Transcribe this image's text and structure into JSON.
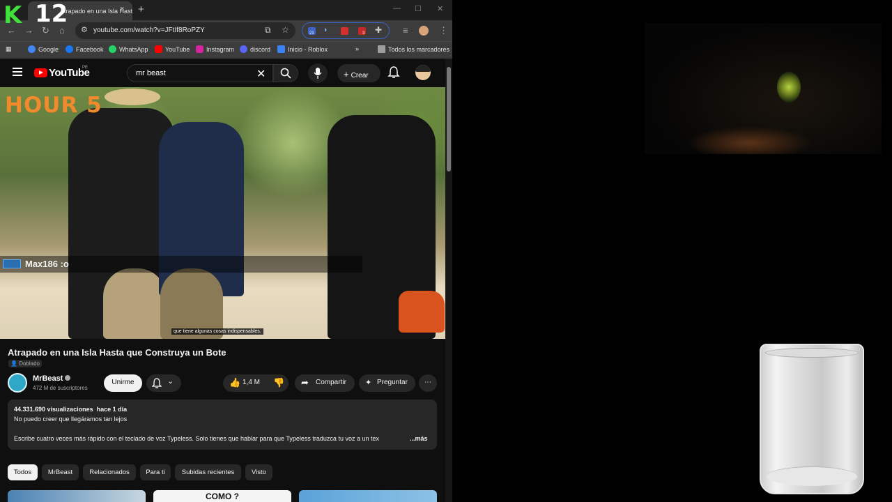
{
  "overlay_logo": {
    "k": "K",
    "num": "12"
  },
  "tab": {
    "title": "Atrapado en una Isla Hasta que",
    "close": "×",
    "new": "+"
  },
  "window_controls": {
    "minimize": "—",
    "maximize": "☐",
    "close": "✕"
  },
  "address": {
    "url": "youtube.com/watch?v=JFtIf8RoPZY"
  },
  "bookmarks": [
    {
      "label": "Google",
      "color": "#4285f4"
    },
    {
      "label": "Facebook",
      "color": "#1877f2"
    },
    {
      "label": "WhatsApp",
      "color": "#25d366"
    },
    {
      "label": "YouTube",
      "color": "#ff0000"
    },
    {
      "label": "Instagram",
      "color": "#d6249f"
    },
    {
      "label": "discord",
      "color": "#5865f2"
    },
    {
      "label": "Inicio - Roblox",
      "color": "#3b82f6"
    }
  ],
  "bookmarks_more": "»",
  "all_bookmarks": "Todos los marcadores",
  "extensions": {
    "badge1": "21",
    "badge2": "3"
  },
  "youtube": {
    "logo": "YouTube",
    "country": "PE",
    "search_value": "mr beast",
    "create_label": "Crear"
  },
  "video": {
    "overlay_title": "HOUR 5",
    "chat_text": "Max186 :o",
    "subtitle": "que tiene algunas cosas indispensables.",
    "title": "Atrapado en una Isla Hasta que Construya un Bote",
    "dubbed": "Doblado"
  },
  "channel": {
    "name": "MrBeast",
    "subscribers": "472 M de suscriptores",
    "join_label": "Unirme"
  },
  "actions": {
    "likes": "1,4 M",
    "share": "Compartir",
    "ask": "Preguntar"
  },
  "description": {
    "views": "44.331.690 visualizaciones",
    "date": "hace 1 día",
    "line1": "No puedo creer que llegáramos tan lejos",
    "line2": "Escribe cuatro veces más rápido con el teclado de voz Typeless. Solo tienes que hablar para que Typeless traduzca tu voz a un tex",
    "more": "...más"
  },
  "chips": [
    "Todos",
    "MrBeast",
    "Relacionados",
    "Para ti",
    "Subidas recientes",
    "Visto"
  ],
  "thumb_text": "COMO ?"
}
